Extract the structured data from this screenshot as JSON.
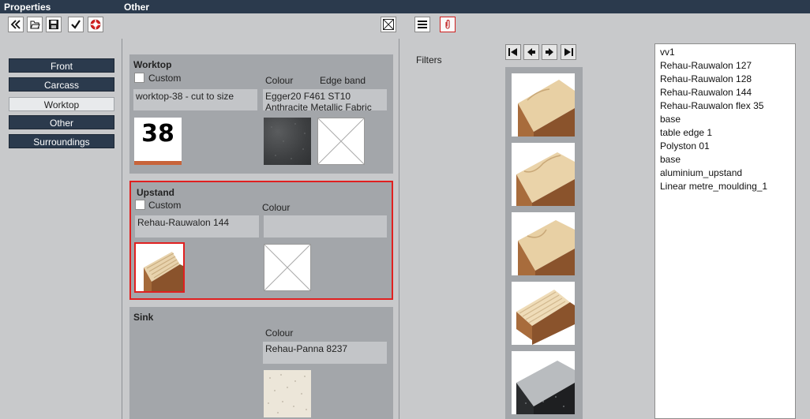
{
  "titlebar": {
    "left_title": "Properties",
    "right_title": "Other"
  },
  "toolbar": {
    "icons": [
      "double-chevron-left-icon",
      "open-folder-icon",
      "save-icon",
      "checkmark-icon",
      "lifebuoy-icon",
      "crossed-box-icon",
      "list-icon",
      "paperclip-icon"
    ]
  },
  "sidebar": {
    "items": [
      {
        "label": "Front",
        "active": false
      },
      {
        "label": "Carcass",
        "active": false
      },
      {
        "label": "Worktop",
        "active": true
      },
      {
        "label": "Other",
        "active": false
      },
      {
        "label": "Surroundings",
        "active": false
      }
    ]
  },
  "worktop": {
    "title": "Worktop",
    "custom_label": "Custom",
    "colour_label": "Colour",
    "edgeband_label": "Edge band",
    "name_value": "worktop-38 - cut to size",
    "colour_value": "Egger20 F461 ST10 Anthracite Metallic Fabric",
    "thickness_badge": "38",
    "badge_stripe_color": "#c8643a"
  },
  "upstand": {
    "title": "Upstand",
    "custom_label": "Custom",
    "colour_label": "Colour",
    "name_value": "Rehau-Rauwalon 144",
    "colour_value": "",
    "highlight_color": "#e02020"
  },
  "sink": {
    "title": "Sink",
    "colour_label": "Colour",
    "colour_value": "Rehau-Panna 8237"
  },
  "filters": {
    "label": "Filters"
  },
  "pager": {
    "icons": [
      "first-page-icon",
      "previous-page-icon",
      "next-page-icon",
      "last-page-icon"
    ]
  },
  "catalog": {
    "items": [
      "vv1",
      "Rehau-Rauwalon 127",
      "Rehau-Rauwalon 128",
      "Rehau-Rauwalon 144",
      "Rehau-Rauwalon flex 35",
      "base",
      "table edge 1",
      "Polyston 01",
      "base",
      "aluminium_upstand",
      "Linear metre_moulding_1"
    ]
  }
}
